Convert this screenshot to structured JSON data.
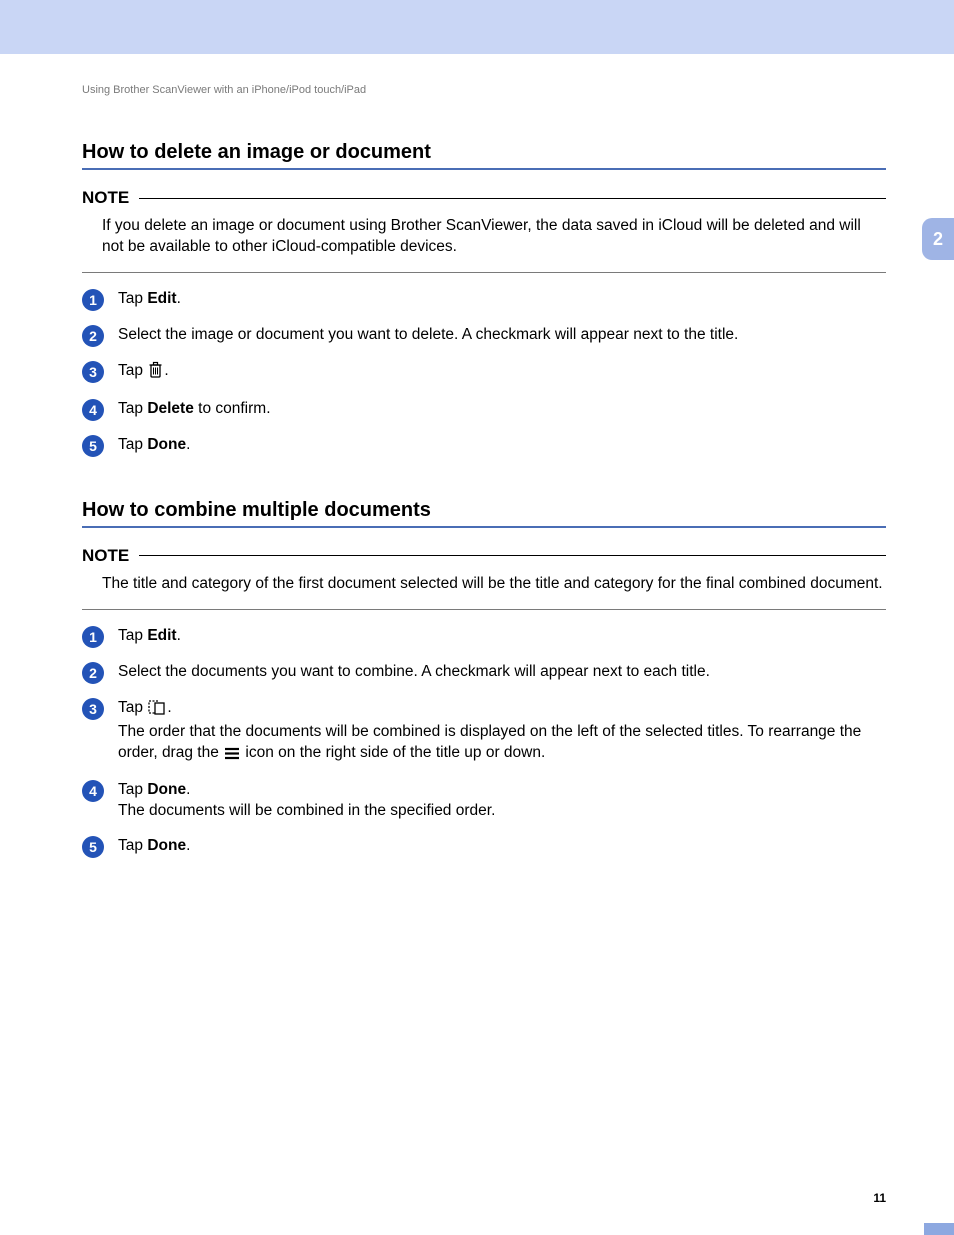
{
  "breadcrumb": "Using Brother ScanViewer with an iPhone/iPod touch/iPad",
  "chapter_tab": "2",
  "page_number": "11",
  "sections": [
    {
      "title": "How to delete an image or document",
      "note_label": "NOTE",
      "note_body": "If you delete an image or document using Brother ScanViewer, the data saved in iCloud will be deleted and will not be available to other iCloud-compatible devices.",
      "steps": [
        {
          "num": "1",
          "pre": "Tap ",
          "bold": "Edit",
          "post": "."
        },
        {
          "num": "2",
          "plain": "Select the image or document you want to delete. A checkmark will appear next to the title."
        },
        {
          "num": "3",
          "pre": "Tap ",
          "icon": "trash",
          "post": "."
        },
        {
          "num": "4",
          "pre": "Tap ",
          "bold": "Delete",
          "post": " to confirm."
        },
        {
          "num": "5",
          "pre": "Tap ",
          "bold": "Done",
          "post": "."
        }
      ]
    },
    {
      "title": "How to combine multiple documents",
      "note_label": "NOTE",
      "note_body": "The title and category of the first document selected will be the title and category for the final combined document.",
      "steps": [
        {
          "num": "1",
          "pre": "Tap ",
          "bold": "Edit",
          "post": "."
        },
        {
          "num": "2",
          "plain": "Select the documents you want to combine. A checkmark will appear next to each title."
        },
        {
          "num": "3",
          "pre": "Tap ",
          "icon": "combine",
          "post": ".",
          "extra_pre": "The order that the documents will be combined is displayed on the left of the selected titles. To rearrange the order, drag the ",
          "extra_icon": "drag",
          "extra_post": " icon on the right side of the title up or down."
        },
        {
          "num": "4",
          "pre": "Tap ",
          "bold": "Done",
          "post": ".",
          "extra_plain": "The documents will be combined in the specified order."
        },
        {
          "num": "5",
          "pre": "Tap ",
          "bold": "Done",
          "post": "."
        }
      ]
    }
  ]
}
